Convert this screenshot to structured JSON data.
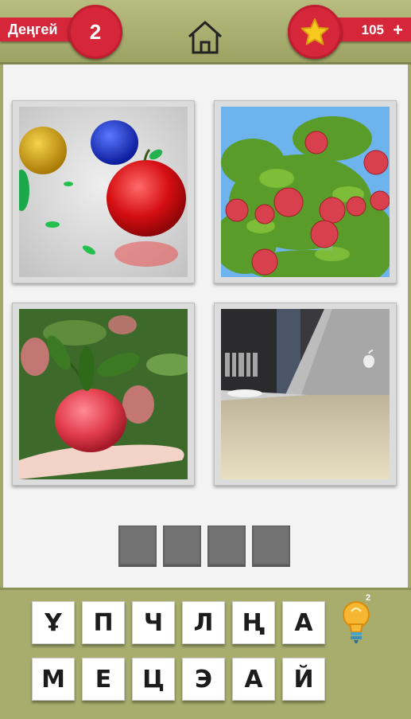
{
  "header": {
    "level_label": "Деңгей",
    "level_number": "2",
    "coins": "105",
    "add_coins_symbol": "+"
  },
  "pictures": [
    {
      "name": "glass-apples-image"
    },
    {
      "name": "apple-tree-image"
    },
    {
      "name": "apple-in-hand-image"
    },
    {
      "name": "laptop-logo-image"
    }
  ],
  "answer_slots": [
    "",
    "",
    "",
    ""
  ],
  "letters": {
    "row1": [
      "Ұ",
      "П",
      "Ч",
      "Л",
      "Ң",
      "А"
    ],
    "row2": [
      "М",
      "Е",
      "Ц",
      "Э",
      "А",
      "Й"
    ]
  },
  "hint": {
    "count": "2"
  },
  "colors": {
    "accent_red": "#d6263a",
    "bar_olive": "#a4a96a",
    "slot_gray": "#727272"
  }
}
